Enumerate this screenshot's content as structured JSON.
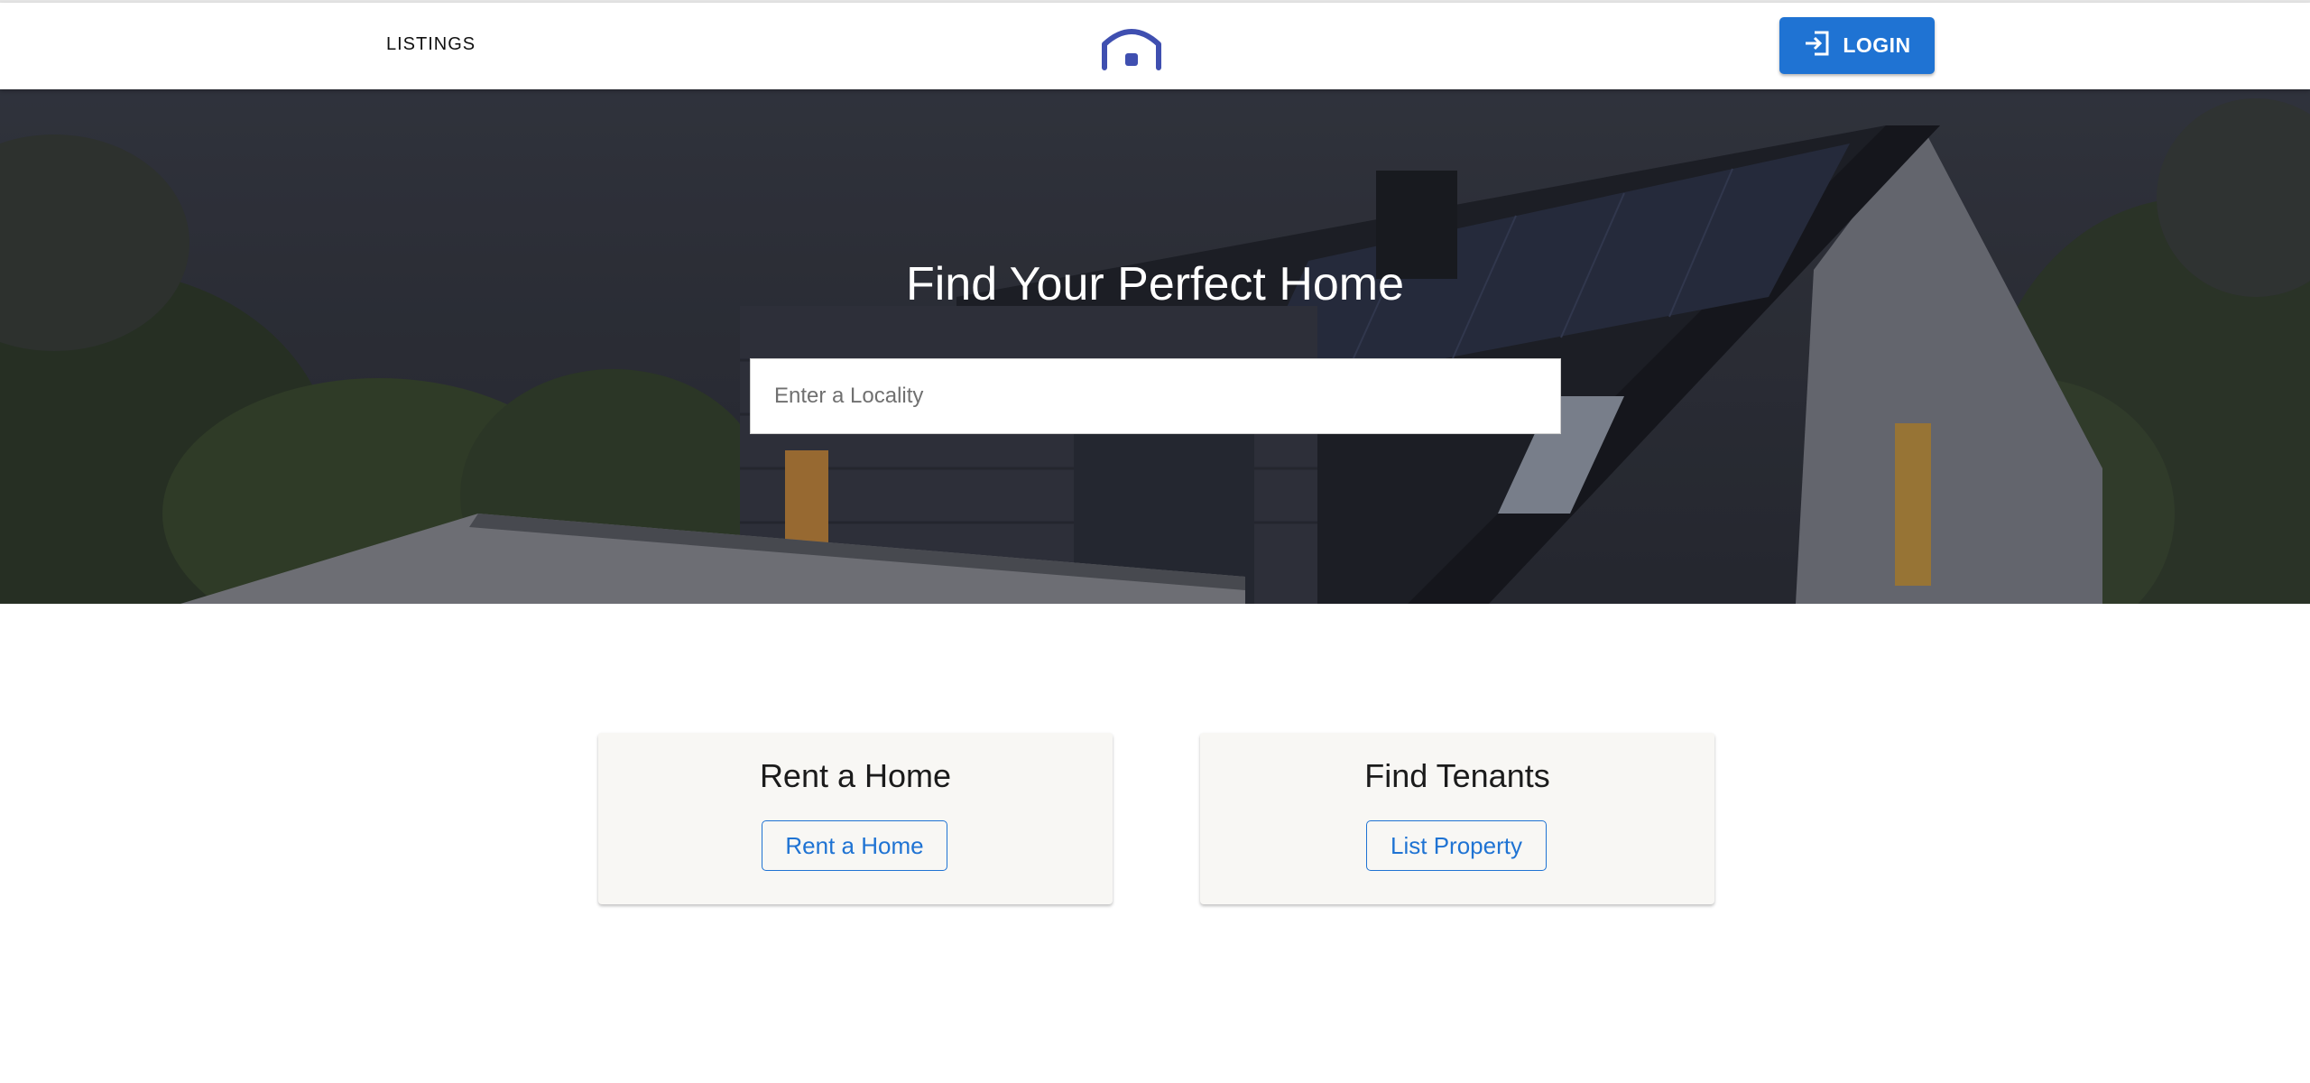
{
  "nav": {
    "listings_label": "LISTINGS",
    "logo_icon": "home-icon",
    "login_label": "LOGIN",
    "login_icon": "login-icon"
  },
  "hero": {
    "title": "Find Your Perfect Home",
    "search_placeholder": "Enter a Locality",
    "search_value": ""
  },
  "cards": [
    {
      "title": "Rent a Home",
      "button_label": "Rent a Home"
    },
    {
      "title": "Find Tenants",
      "button_label": "List Property"
    }
  ],
  "colors": {
    "primary": "#1f73d3",
    "logo": "#3f4fb0",
    "card_background": "#f8f7f4"
  }
}
